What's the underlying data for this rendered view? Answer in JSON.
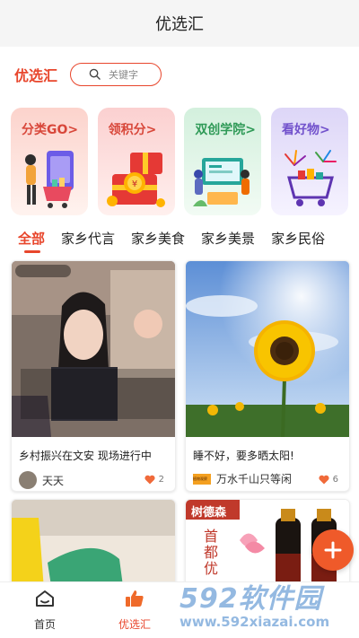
{
  "header": {
    "title": "优选汇"
  },
  "search": {
    "brand": "优选汇",
    "placeholder": "关键字"
  },
  "categories": [
    {
      "label": "分类GO>",
      "icon": "shopping-cart-woman-icon"
    },
    {
      "label": "领积分>",
      "icon": "gift-coins-icon"
    },
    {
      "label": "双创学院>",
      "icon": "classroom-icon"
    },
    {
      "label": "看好物>",
      "icon": "fireworks-cart-icon"
    }
  ],
  "tabs": [
    "全部",
    "家乡代言",
    "家乡美食",
    "家乡美景",
    "家乡民俗"
  ],
  "cards": [
    {
      "title": "乡村振兴在文安 现场进行中",
      "author": "天天",
      "likes": "2"
    },
    {
      "title": "睡不好，要多晒太阳!",
      "author": "万水千山只等闲",
      "author_badge": "植物观察",
      "likes": "6"
    },
    {
      "title": "",
      "author": "",
      "likes": ""
    },
    {
      "title": "",
      "author": "",
      "likes": "",
      "image_text": "树德森",
      "image_text2": "首都优"
    }
  ],
  "bottom_nav": [
    {
      "label": "首页",
      "icon": "home-icon"
    },
    {
      "label": "优选汇",
      "icon": "thumbs-up-icon"
    }
  ],
  "watermark": {
    "line1": "592软件园",
    "line2": "www.592xiazai.com"
  },
  "colors": {
    "accent": "#e8462c",
    "fab": "#ef5a2a"
  }
}
